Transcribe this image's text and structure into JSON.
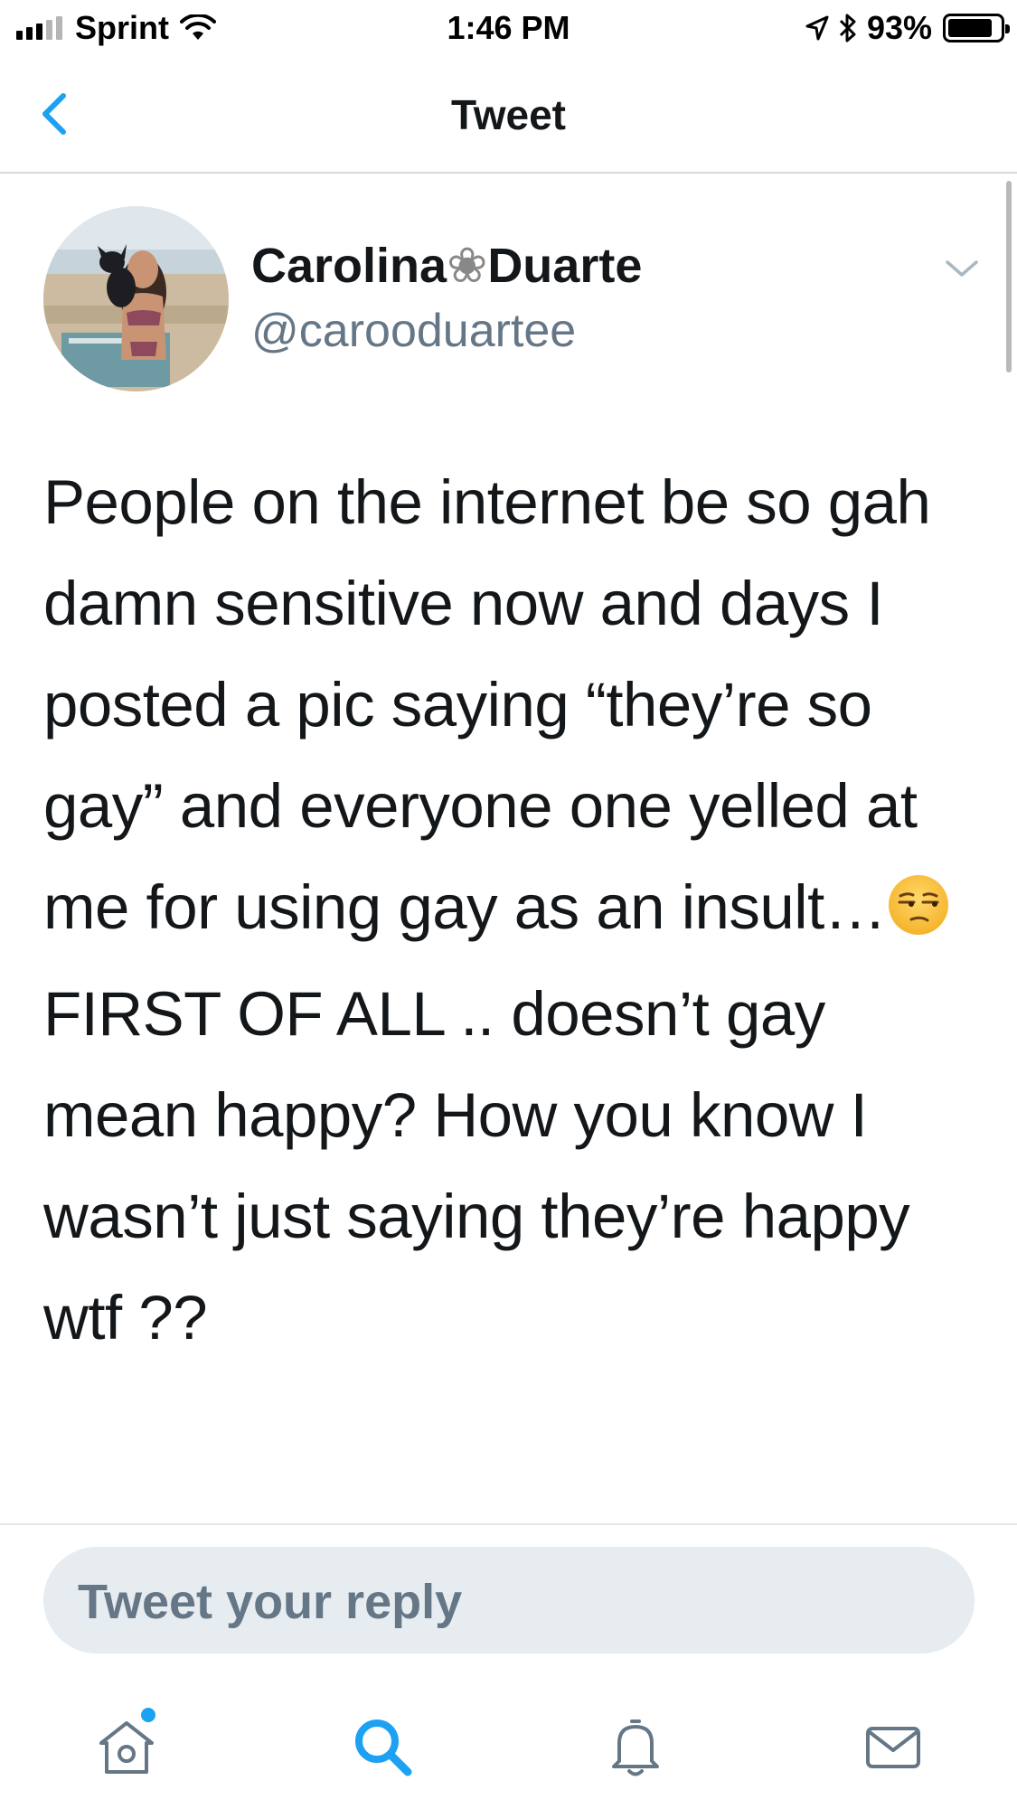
{
  "status_bar": {
    "carrier": "Sprint",
    "time": "1:46 PM",
    "battery": "93%",
    "battery_level": 0.93,
    "signal_bars_active": 3,
    "signal_bars_total": 5
  },
  "nav": {
    "title": "Tweet"
  },
  "tweet": {
    "author_first": "Carolina",
    "author_separator": "❀",
    "author_last": "Duarte",
    "handle": "@carooduartee",
    "paragraphs": [
      "People on the internet be so gah damn sensitive now and days I posted a pic saying “they’re so gay” and everyone one yelled at me for using gay as an insult…",
      "FIRST OF ALL .. doesn’t gay mean happy? How you know I wasn’t just saying they’re happy wtf ??"
    ],
    "emoji": "unamused-face"
  },
  "reply": {
    "placeholder": "Tweet your reply"
  },
  "tab_bar": {
    "items": [
      "home-icon",
      "search-icon",
      "bell-icon",
      "mail-icon"
    ],
    "active_color": "#1da1f2",
    "inactive_color": "#657786"
  },
  "colors": {
    "accent": "#1da1f2",
    "text": "#14171a",
    "secondary": "#657786",
    "reply_bg": "#e6ecf0"
  }
}
